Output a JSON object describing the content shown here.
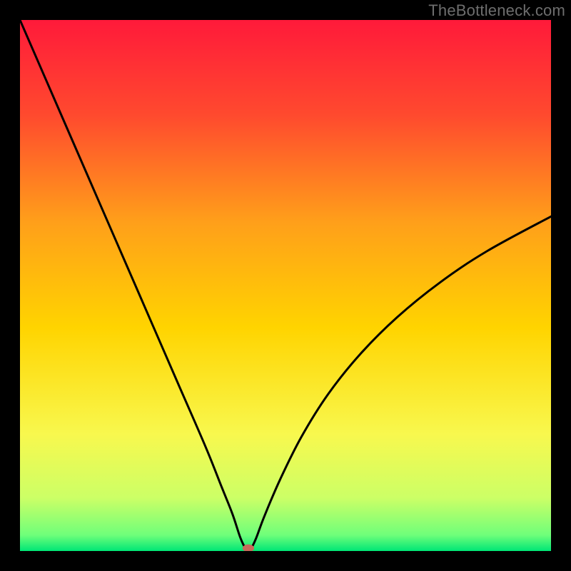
{
  "watermark": "TheBottleneck.com",
  "chart_data": {
    "type": "line",
    "title": "",
    "xlabel": "",
    "ylabel": "",
    "xlim": [
      0,
      100
    ],
    "ylim": [
      0,
      100
    ],
    "grid": false,
    "legend": false,
    "background_gradient_stops": [
      {
        "offset": 0.0,
        "color": "#ff1a3a"
      },
      {
        "offset": 0.18,
        "color": "#ff4a2e"
      },
      {
        "offset": 0.38,
        "color": "#ff9f1a"
      },
      {
        "offset": 0.58,
        "color": "#ffd400"
      },
      {
        "offset": 0.78,
        "color": "#f8f84e"
      },
      {
        "offset": 0.9,
        "color": "#ccff66"
      },
      {
        "offset": 0.97,
        "color": "#6fff7a"
      },
      {
        "offset": 1.0,
        "color": "#00e676"
      }
    ],
    "series": [
      {
        "name": "bottleneck-curve",
        "x": [
          0.0,
          5.0,
          10.0,
          15.0,
          20.0,
          25.0,
          30.0,
          35.0,
          38.0,
          40.0,
          41.5,
          42.5,
          43.0,
          43.5,
          44.5,
          46.0,
          49.0,
          53.0,
          58.0,
          64.0,
          71.0,
          79.0,
          88.0,
          100.0
        ],
        "y": [
          100.0,
          88.5,
          77.0,
          65.5,
          54.0,
          42.5,
          31.0,
          19.5,
          12.0,
          7.0,
          2.5,
          0.4,
          0.0,
          0.4,
          2.5,
          6.5,
          13.5,
          21.5,
          29.5,
          37.0,
          44.0,
          50.5,
          56.5,
          63.0
        ]
      }
    ],
    "marker": {
      "name": "optimal-point",
      "x": 43.0,
      "y": 0.0,
      "rx": 1.1,
      "ry": 0.7,
      "color": "#c96a5a"
    }
  }
}
